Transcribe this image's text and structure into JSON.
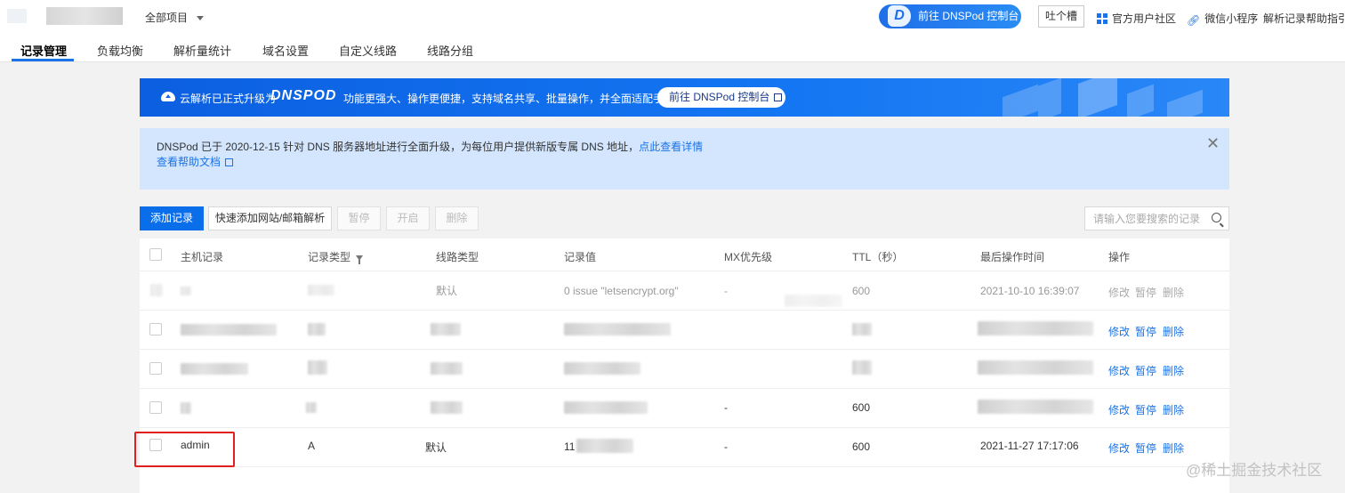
{
  "topbar": {
    "project_selector": "全部项目",
    "goto_console": "前往 DNSPod 控制台",
    "feedback": "吐个槽",
    "community": "官方用户社区",
    "miniprogram": "微信小程序",
    "help_guide": "解析记录帮助指引 |"
  },
  "tabs": [
    "记录管理",
    "负载均衡",
    "解析量统计",
    "域名设置",
    "自定义线路",
    "线路分组"
  ],
  "banner": {
    "text1": "云解析已正式升级为",
    "brand": "DNSPOD",
    "text2": "功能更强大、操作更便捷，支持域名共享、批量操作，并全面适配手机端",
    "button": "前往 DNSPod 控制台"
  },
  "notice": {
    "text": "DNSPod 已于 2020-12-15 针对 DNS 服务器地址进行全面升级，为每位用户提供新版专属 DNS 地址，",
    "detail_link": "点此查看详情",
    "help_link": "查看帮助文档"
  },
  "toolbar": {
    "add": "添加记录",
    "quick_add": "快速添加网站/邮箱解析",
    "pause": "暂停",
    "enable": "开启",
    "delete": "删除",
    "search_placeholder": "请输入您要搜索的记录"
  },
  "table": {
    "headers": {
      "host": "主机记录",
      "type": "记录类型",
      "line": "线路类型",
      "value": "记录值",
      "mx": "MX优先级",
      "ttl": "TTL（秒）",
      "time": "最后操作时间",
      "ops": "操作"
    },
    "actions": {
      "edit": "修改",
      "pause": "暂停",
      "delete": "删除"
    },
    "rows": [
      {
        "host": "",
        "type": "",
        "line": "默认",
        "value": "0 issue \"letsencrypt.org\"",
        "mx": "-",
        "ttl": "600",
        "time": "2021-10-10 16:39:07"
      },
      {
        "host": "",
        "type": "",
        "line": "",
        "value": "",
        "mx": "",
        "ttl": "",
        "time": ""
      },
      {
        "host": "",
        "type": "",
        "line": "",
        "value": "",
        "mx": "",
        "ttl": "",
        "time": ""
      },
      {
        "host": "",
        "type": "",
        "line": "",
        "value": "",
        "mx": "-",
        "ttl": "600",
        "time": ""
      },
      {
        "host": "admin",
        "type": "A",
        "line": "默认",
        "value": "11",
        "mx": "-",
        "ttl": "600",
        "time": "2021-11-27 17:17:06"
      }
    ]
  },
  "watermark": "@稀土掘金技术社区"
}
